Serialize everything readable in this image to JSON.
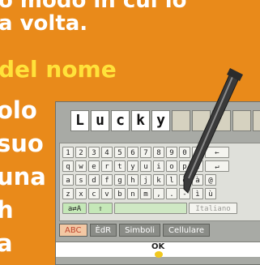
{
  "text": {
    "line_top": "o modo in cui lo",
    "line_volta": "a volta.",
    "heading": "del nome",
    "side_lines": [
      "olo",
      "suo",
      "una",
      "h",
      "a"
    ]
  },
  "screen": {
    "name_letters": [
      "L",
      "u",
      "c",
      "k",
      "y"
    ],
    "empty_slots": 5,
    "keyboard": {
      "row1": [
        "1",
        "2",
        "3",
        "4",
        "5",
        "6",
        "7",
        "8",
        "9",
        "0",
        "'",
        "←"
      ],
      "row2": [
        "q",
        "w",
        "e",
        "r",
        "t",
        "y",
        "u",
        "i",
        "o",
        "p",
        "è",
        "↵"
      ],
      "row3": [
        "a",
        "s",
        "d",
        "f",
        "g",
        "h",
        "j",
        "k",
        "l",
        "ò",
        "à",
        "@"
      ],
      "row4": [
        "z",
        "x",
        "c",
        "v",
        "b",
        "n",
        "m",
        ",",
        ".",
        "-",
        "ì",
        "ù"
      ],
      "row5": [
        "a⇄A",
        "⇧",
        "",
        "Italiano"
      ]
    },
    "modes": [
      "ABC",
      "ÈdR",
      "Simboli",
      "Cellulare"
    ],
    "active_mode": "ABC",
    "ok_label": "OK"
  },
  "colors": {
    "background": "#e98a1a",
    "heading": "#ffe23a"
  }
}
